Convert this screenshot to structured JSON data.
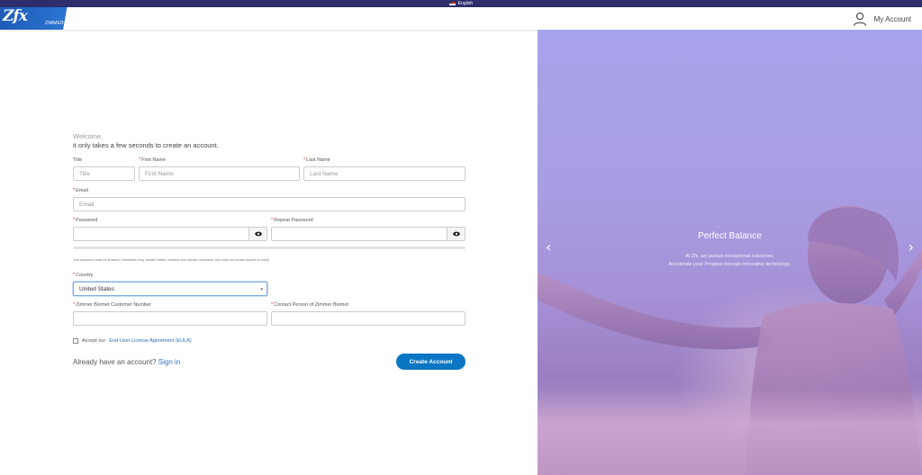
{
  "lang": {
    "label": "English"
  },
  "header": {
    "logo_text": "Zfx",
    "logo_sub": "ZIMMER BIOMET",
    "account_label": "My Account"
  },
  "form": {
    "welcome": "Welcome,",
    "welcome_sub": "it only takes a few seconds to create an account.",
    "title_label": "Title",
    "title_placeholder": "Title",
    "first_name_label": "First Name",
    "first_name_placeholder": "First Name",
    "last_name_label": "Last Name",
    "last_name_placeholder": "Last Name",
    "email_label": "Email",
    "email_placeholder": "Email",
    "password_label": "Password",
    "repeat_password_label": "Repeat Password",
    "password_hint": "Your password must be at least 8 characters long, contain letters, numbers and special characters, and must not contain spaces or emoji.",
    "country_label": "Country",
    "country_value": "United States",
    "customer_number_label": "Zimmer Biomet Customer Number",
    "contact_person_label": "Contact Person of Zimmer Biomet",
    "eula_prefix": "Accept our",
    "eula_link": "End-User License Agreement (EULA)",
    "already_text": "Already have an account?",
    "sign_in": "Sign in",
    "create_button": "Create Account",
    "required_mark": "*"
  },
  "hero": {
    "title": "Perfect Balance",
    "line1": "At Zfx, we pursue exceptional outcomes.",
    "line2": "Accelerate your Progess through innovative technology.",
    "prev_glyph": "‹",
    "next_glyph": "›"
  },
  "colors": {
    "accent": "#0b76c4",
    "header_strip": "#2d2e6b",
    "logo_blue": "#1d5bb5"
  }
}
